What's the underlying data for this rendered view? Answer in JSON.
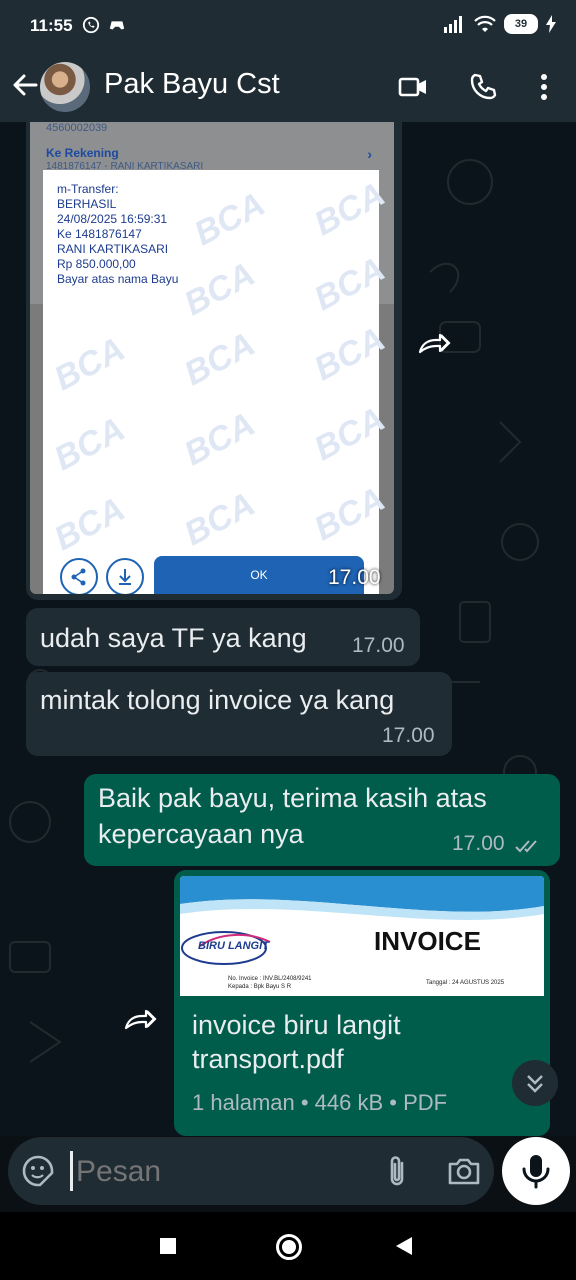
{
  "status_bar": {
    "time": "11:55",
    "battery": "39"
  },
  "header": {
    "contact_name": "Pak Bayu Cst"
  },
  "messages": {
    "image_msg": {
      "time": "17.00",
      "screenshot": {
        "top_number": "4560002039",
        "ke_rekening_label": "Ke Rekening",
        "ke_rekening_value": "1481876147 - RANI KARTIKASARI",
        "receipt_text": "m-Transfer:\nBERHASIL\n24/08/2025 16:59:31\nKe 1481876147\nRANI KARTIKASARI\nRp 850.000,00\nBayar atas nama Bayu",
        "watermark": "BCA",
        "ok_label": "OK"
      }
    },
    "msg1": {
      "text": "udah saya TF ya kang",
      "time": "17.00"
    },
    "msg2": {
      "text": "mintak tolong invoice ya kang",
      "time": "17.00"
    },
    "msg3": {
      "text": "Baik pak bayu, terima kasih atas kepercayaan nya",
      "time": "17.00"
    },
    "doc_msg": {
      "preview": {
        "logo_text": "BIRU LANGIT",
        "title": "INVOICE",
        "no_invoice": "No. Invoice : INV.BL/2408/9241",
        "kepada": "Kepada   : Bpk Bayu S R",
        "tanggal": "Tanggal   : 24 AGUSTUS 2025"
      },
      "filename": "invoice biru langit transport.pdf",
      "meta": "1 halaman • 446 kB • PDF"
    }
  },
  "input": {
    "placeholder": "Pesan"
  },
  "colors": {
    "header_bg": "#1f2c34",
    "incoming_bubble": "#202c33",
    "outgoing_bubble": "#005c4b",
    "chat_bg": "#0b141a"
  }
}
